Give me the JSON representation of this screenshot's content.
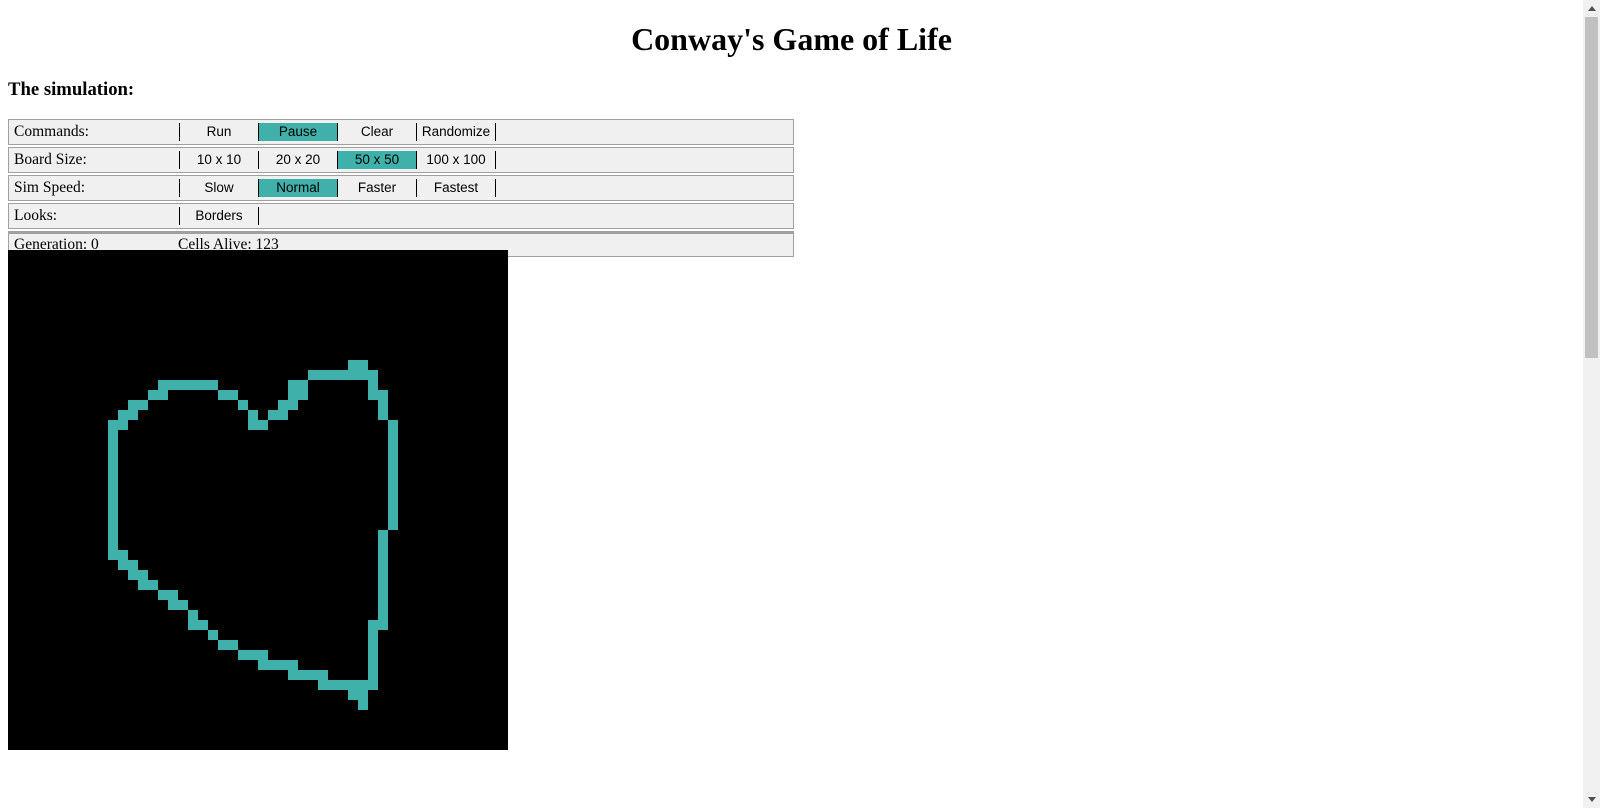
{
  "title": "Conway's Game of Life",
  "subtitle": "The simulation:",
  "colors": {
    "accent": "#40b0aa",
    "board_bg": "#000000",
    "cell": "#40b0aa",
    "panel_bg": "#f0f0f0"
  },
  "controls": {
    "commands": {
      "label": "Commands:",
      "buttons": [
        {
          "label": "Run",
          "active": false
        },
        {
          "label": "Pause",
          "active": true
        },
        {
          "label": "Clear",
          "active": false
        },
        {
          "label": "Randomize",
          "active": false
        }
      ]
    },
    "board_size": {
      "label": "Board Size:",
      "buttons": [
        {
          "label": "10 x 10",
          "active": false
        },
        {
          "label": "20 x 20",
          "active": false
        },
        {
          "label": "50 x 50",
          "active": true
        },
        {
          "label": "100 x 100",
          "active": false
        }
      ]
    },
    "sim_speed": {
      "label": "Sim Speed:",
      "buttons": [
        {
          "label": "Slow",
          "active": false
        },
        {
          "label": "Normal",
          "active": true
        },
        {
          "label": "Faster",
          "active": false
        },
        {
          "label": "Fastest",
          "active": false
        }
      ]
    },
    "looks": {
      "label": "Looks:",
      "buttons": [
        {
          "label": "Borders",
          "active": false
        }
      ]
    }
  },
  "status": {
    "generation": "Generation: 0",
    "cells_alive": "Cells Alive: 123"
  },
  "board": {
    "grid_size": 50,
    "live_cells": [
      [
        34,
        11
      ],
      [
        35,
        11
      ],
      [
        30,
        12
      ],
      [
        31,
        12
      ],
      [
        32,
        12
      ],
      [
        33,
        12
      ],
      [
        34,
        12
      ],
      [
        35,
        12
      ],
      [
        36,
        12
      ],
      [
        15,
        13
      ],
      [
        16,
        13
      ],
      [
        17,
        13
      ],
      [
        18,
        13
      ],
      [
        19,
        13
      ],
      [
        20,
        13
      ],
      [
        28,
        13
      ],
      [
        29,
        13
      ],
      [
        36,
        13
      ],
      [
        14,
        14
      ],
      [
        15,
        14
      ],
      [
        21,
        14
      ],
      [
        22,
        14
      ],
      [
        28,
        14
      ],
      [
        29,
        14
      ],
      [
        36,
        14
      ],
      [
        37,
        14
      ],
      [
        12,
        15
      ],
      [
        13,
        15
      ],
      [
        23,
        15
      ],
      [
        27,
        15
      ],
      [
        28,
        15
      ],
      [
        37,
        15
      ],
      [
        11,
        16
      ],
      [
        12,
        16
      ],
      [
        24,
        16
      ],
      [
        26,
        16
      ],
      [
        27,
        16
      ],
      [
        37,
        16
      ],
      [
        10,
        17
      ],
      [
        11,
        17
      ],
      [
        24,
        17
      ],
      [
        25,
        17
      ],
      [
        38,
        17
      ],
      [
        10,
        18
      ],
      [
        38,
        18
      ],
      [
        10,
        19
      ],
      [
        38,
        19
      ],
      [
        10,
        20
      ],
      [
        38,
        20
      ],
      [
        10,
        21
      ],
      [
        38,
        21
      ],
      [
        10,
        22
      ],
      [
        38,
        22
      ],
      [
        10,
        23
      ],
      [
        38,
        23
      ],
      [
        10,
        24
      ],
      [
        38,
        24
      ],
      [
        10,
        25
      ],
      [
        38,
        25
      ],
      [
        10,
        26
      ],
      [
        38,
        26
      ],
      [
        10,
        27
      ],
      [
        38,
        27
      ],
      [
        10,
        28
      ],
      [
        37,
        28
      ],
      [
        10,
        29
      ],
      [
        37,
        29
      ],
      [
        10,
        30
      ],
      [
        11,
        30
      ],
      [
        37,
        30
      ],
      [
        11,
        31
      ],
      [
        12,
        31
      ],
      [
        37,
        31
      ],
      [
        12,
        32
      ],
      [
        13,
        32
      ],
      [
        37,
        32
      ],
      [
        13,
        33
      ],
      [
        14,
        33
      ],
      [
        37,
        33
      ],
      [
        15,
        34
      ],
      [
        16,
        34
      ],
      [
        37,
        34
      ],
      [
        16,
        35
      ],
      [
        17,
        35
      ],
      [
        37,
        35
      ],
      [
        18,
        36
      ],
      [
        37,
        36
      ],
      [
        18,
        37
      ],
      [
        19,
        37
      ],
      [
        36,
        37
      ],
      [
        37,
        37
      ],
      [
        20,
        38
      ],
      [
        36,
        38
      ],
      [
        21,
        39
      ],
      [
        22,
        39
      ],
      [
        36,
        39
      ],
      [
        23,
        40
      ],
      [
        24,
        40
      ],
      [
        25,
        40
      ],
      [
        36,
        40
      ],
      [
        25,
        41
      ],
      [
        26,
        41
      ],
      [
        27,
        41
      ],
      [
        28,
        41
      ],
      [
        36,
        41
      ],
      [
        28,
        42
      ],
      [
        29,
        42
      ],
      [
        30,
        42
      ],
      [
        31,
        42
      ],
      [
        36,
        42
      ],
      [
        31,
        43
      ],
      [
        32,
        43
      ],
      [
        33,
        43
      ],
      [
        34,
        43
      ],
      [
        35,
        43
      ],
      [
        36,
        43
      ],
      [
        34,
        44
      ],
      [
        35,
        44
      ],
      [
        35,
        45
      ]
    ]
  }
}
